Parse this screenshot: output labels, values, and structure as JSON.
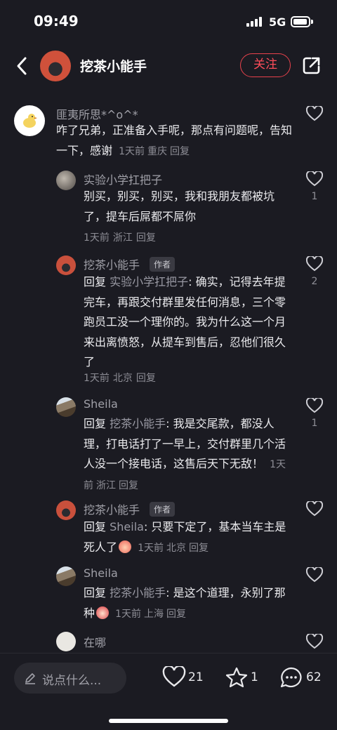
{
  "status": {
    "time": "09:49",
    "network": "5G"
  },
  "header": {
    "title": "挖茶小能手",
    "follow_label": "关注"
  },
  "labels": {
    "author_tag": "作者"
  },
  "comments": [
    {
      "user": "匪夷所思*^o^*",
      "text": "咋了兄弟，正准备入手呢，那点有问题呢，告知一下，感谢",
      "time": "1天前",
      "location": "重庆",
      "reply_label": "回复"
    },
    {
      "user": "实验小学扛把子",
      "text": "别买，别买，别买，我和我朋友都被坑了，提车后屌都不屌你",
      "time": "1天前",
      "location": "浙江",
      "reply_label": "回复",
      "likes": "1"
    },
    {
      "user": "挖茶小能手",
      "reply_prefix": "回复",
      "reply_to": "实验小学扛把子",
      "text": ": 确实，记得去年提完车，再跟交付群里发任何消息，三个零跑员工没一个理你的。我为什么这一个月来出离愤怒，从提车到售后，忍他们很久了",
      "time": "1天前",
      "location": "北京",
      "reply_label": "回复",
      "likes": "2"
    },
    {
      "user": "Sheila",
      "reply_prefix": "回复",
      "reply_to": "挖茶小能手",
      "text": ": 我是交尾款，都没人理，打电话打了一早上，交付群里几个活人没一个接电话，这售后天下无敌！",
      "time": "1天前",
      "location": "浙江",
      "reply_label": "回复",
      "likes": "1"
    },
    {
      "user": "挖茶小能手",
      "reply_prefix": "回复",
      "reply_to": "Sheila",
      "text": ": 只要下定了，基本当车主是死人了",
      "time": "1天前",
      "location": "北京",
      "reply_label": "回复"
    },
    {
      "user": "Sheila",
      "reply_prefix": "回复",
      "reply_to": "挖茶小能手",
      "text": ": 是这个道理，永别了那种",
      "time": "1天前",
      "location": "上海",
      "reply_label": "回复"
    },
    {
      "user": "在哪"
    }
  ],
  "bottom": {
    "input_placeholder": "说点什么...",
    "likes": "21",
    "favorites": "1",
    "comments": "62"
  }
}
